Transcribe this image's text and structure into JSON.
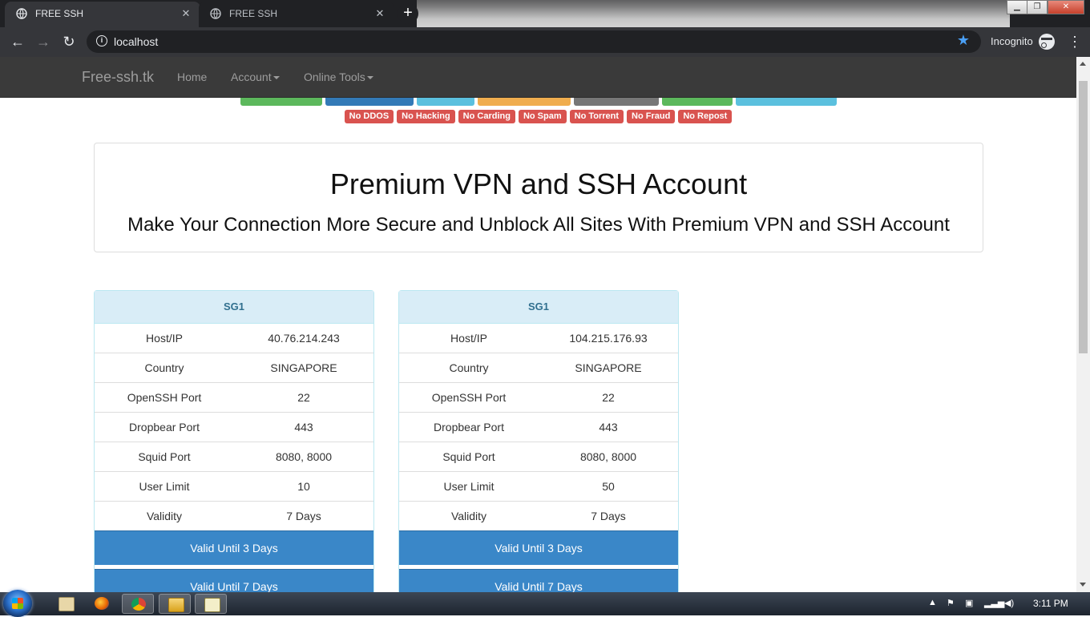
{
  "browser": {
    "tabs": [
      {
        "title": "FREE SSH",
        "active": true
      },
      {
        "title": "FREE SSH",
        "active": false
      }
    ],
    "url": "localhost",
    "profile_label": "Incognito",
    "icons": [
      "back-icon",
      "forward-icon",
      "reload-icon",
      "info-icon",
      "star-icon",
      "incognito-icon",
      "menu-icon"
    ]
  },
  "navbar": {
    "brand": "Free-ssh.tk",
    "links": [
      {
        "label": "Home"
      },
      {
        "label": "Account",
        "dropdown": true
      },
      {
        "label": "Online Tools",
        "dropdown": true
      }
    ]
  },
  "rules_badges": [
    "No DDOS",
    "No Hacking",
    "No Carding",
    "No Spam",
    "No Torrent",
    "No Fraud",
    "No Repost"
  ],
  "feature_badge_colors": [
    "#5cb85c",
    "#337ab7",
    "#5bc0de",
    "#f0ad4e",
    "#777777",
    "#5cb85c",
    "#5bc0de"
  ],
  "hero": {
    "title": "Premium VPN and SSH Account",
    "subtitle": "Make Your Connection More Secure and Unblock All Sites With Premium VPN and SSH Account"
  },
  "servers": [
    {
      "name": "SG1",
      "rows": [
        {
          "label": "Host/IP",
          "value": "40.76.214.243"
        },
        {
          "label": "Country",
          "value": "SINGAPORE"
        },
        {
          "label": "OpenSSH Port",
          "value": "22"
        },
        {
          "label": "Dropbear Port",
          "value": "443"
        },
        {
          "label": "Squid Port",
          "value": "8080, 8000"
        },
        {
          "label": "User Limit",
          "value": "10"
        },
        {
          "label": "Validity",
          "value": "7 Days"
        }
      ],
      "buttons": [
        "Valid Until 3 Days",
        "Valid Until 7 Days"
      ]
    },
    {
      "name": "SG1",
      "rows": [
        {
          "label": "Host/IP",
          "value": "104.215.176.93"
        },
        {
          "label": "Country",
          "value": "SINGAPORE"
        },
        {
          "label": "OpenSSH Port",
          "value": "22"
        },
        {
          "label": "Dropbear Port",
          "value": "443"
        },
        {
          "label": "Squid Port",
          "value": "8080, 8000"
        },
        {
          "label": "User Limit",
          "value": "50"
        },
        {
          "label": "Validity",
          "value": "7 Days"
        }
      ],
      "buttons": [
        "Valid Until 3 Days",
        "Valid Until 7 Days"
      ]
    }
  ],
  "taskbar": {
    "clock": "3:11 PM",
    "apps": [
      "paint-icon",
      "firefox-icon",
      "chrome-icon",
      "explorer-icon",
      "notepad-icon"
    ],
    "active_app": "chrome-icon"
  },
  "colors": {
    "navbar_bg": "#3a3a3a",
    "panel_head_bg": "#d9edf7",
    "button_blue": "#3a87c8",
    "danger": "#d9534f"
  }
}
